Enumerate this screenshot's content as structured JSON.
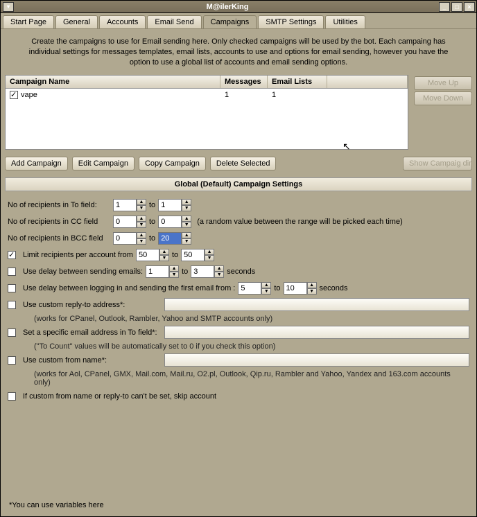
{
  "window": {
    "title": "M@ilerKing"
  },
  "tabs": [
    {
      "label": "Start Page"
    },
    {
      "label": "General"
    },
    {
      "label": "Accounts"
    },
    {
      "label": "Email Send"
    },
    {
      "label": "Campaigns",
      "active": true
    },
    {
      "label": "SMTP Settings"
    },
    {
      "label": "Utilities"
    }
  ],
  "description": "Create the campaigns to use for Email sending here. Only checked campaigns will be used by the bot. Each campaing has individual settings for messages templates, email lists, accounts to use and options for email sending, however you have the option to use a global list of accounts and email sending options.",
  "columns": {
    "name": "Campaign Name",
    "messages": "Messages",
    "lists": "Email Lists"
  },
  "rows": [
    {
      "checked": true,
      "name": "vape",
      "messages": "1",
      "lists": "1"
    }
  ],
  "sideButtons": {
    "moveUp": "Move Up",
    "moveDown": "Move Down",
    "showDir": "Show Campaig dir"
  },
  "rowButtons": {
    "add": "Add Campaign",
    "edit": "Edit Campaign",
    "copy": "Copy Campaign",
    "del": "Delete Selected"
  },
  "settingsTitle": "Global (Default) Campaign Settings",
  "labels": {
    "toField": "No of recipients in To field:",
    "ccField": "No of recipients in CC field",
    "bccField": "No of recipients in BCC field",
    "to": "to",
    "randomNote": "(a random value between the range will be picked each time)",
    "limitRecipients": "Limit recipients per account from",
    "useDelayEmails": "Use delay between sending emails:",
    "seconds": "seconds",
    "useDelayLogin": "Use delay between logging in and sending the first email from :",
    "customReply": "Use custom reply-to address*:",
    "customReplyNote": "(works for CPanel, Outlook, Rambler, Yahoo and SMTP accounts only)",
    "specificTo": "Set a specific email address in To field*:",
    "specificToNote": "(\"To Count\" values will be automatically set to 0 if you check this option)",
    "customFrom": "Use custom from name*:",
    "customFromNote": "(works for Aol, CPanel, GMX, Mail.com, Mail.ru, O2.pl, Outlook, Qip.ru, Rambler and Yahoo, Yandex and 163.com accounts only)",
    "skipAccount": "If custom from name or reply-to can't be set, skip account"
  },
  "values": {
    "toFrom": "1",
    "toTo": "1",
    "ccFrom": "0",
    "ccTo": "0",
    "bccFrom": "0",
    "bccTo": "20",
    "limitFrom": "50",
    "limitTo": "50",
    "delayEmailsFrom": "1",
    "delayEmailsTo": "3",
    "delayLoginFrom": "5",
    "delayLoginTo": "10"
  },
  "checks": {
    "limitRecipients": true,
    "useDelayEmails": false,
    "useDelayLogin": false,
    "customReply": false,
    "specificTo": false,
    "customFrom": false,
    "skipAccount": false
  },
  "footer": "*You can use variables here"
}
